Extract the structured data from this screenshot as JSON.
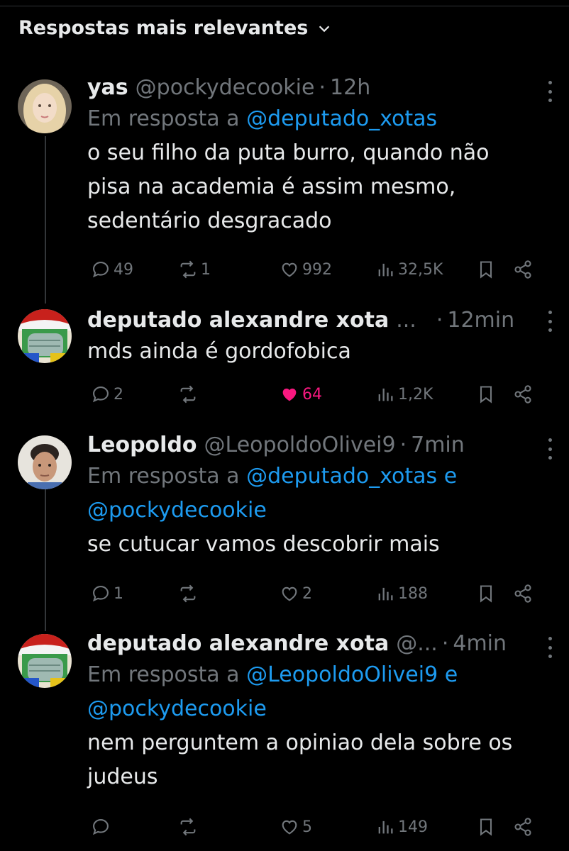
{
  "sort": {
    "label": "Respostas mais relevantes",
    "icon": "chevron-down-icon"
  },
  "posts": [
    {
      "name": "yas",
      "handle": "@pockydecookie",
      "time": "12h",
      "reply_prefix": "Em resposta a",
      "reply_mentions": "@deputado_xotas",
      "reply_mentions_line2": "",
      "lines": [
        "o seu filho da puta burro, quando não",
        "pisa na academia é assim mesmo,",
        "sedentário desgracado"
      ],
      "replies": "49",
      "reposts": "1",
      "likes": "992",
      "views": "32,5K",
      "liked": false
    },
    {
      "name": "deputado alexandre xota",
      "handle": "...",
      "time": "12min",
      "reply_prefix": "",
      "reply_mentions": "",
      "reply_mentions_line2": "",
      "lines": [
        "mds ainda é gordofobica"
      ],
      "replies": "2",
      "reposts": "",
      "likes": "64",
      "views": "1,2K",
      "liked": true
    },
    {
      "name": "Leopoldo",
      "handle": "@LeopoldoOlivei9",
      "time": "7min",
      "reply_prefix": "Em resposta a",
      "reply_mentions": "@deputado_xotas e",
      "reply_mentions_line2": "@pockydecookie",
      "lines": [
        "se cutucar vamos descobrir mais"
      ],
      "replies": "1",
      "reposts": "",
      "likes": "2",
      "views": "188",
      "liked": false
    },
    {
      "name": "deputado alexandre xota",
      "handle": "@...",
      "time": "4min",
      "reply_prefix": "Em resposta a",
      "reply_mentions": "@LeopoldoOlivei9 e",
      "reply_mentions_line2": "@pockydecookie",
      "lines": [
        "nem perguntem a opiniao dela sobre os",
        "judeus"
      ],
      "replies": "",
      "reposts": "",
      "likes": "5",
      "views": "149",
      "liked": false
    }
  ],
  "colors": {
    "background": "#000000",
    "text": "#e7e9ea",
    "muted": "#71767b",
    "link": "#1d9bf0",
    "like": "#f91880"
  }
}
